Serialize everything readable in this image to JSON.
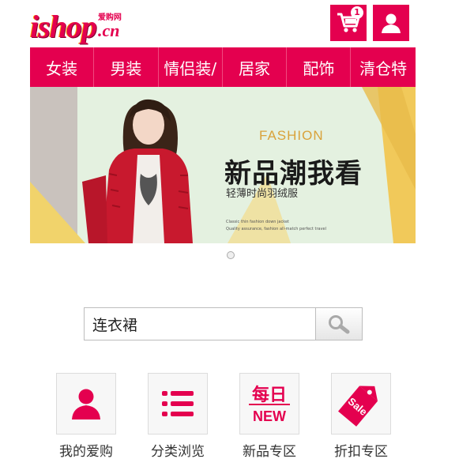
{
  "header": {
    "logo_main": "ishop",
    "logo_sub": "爱购网",
    "logo_suffix": ".cn",
    "cart_icon": "cart-icon",
    "cart_count": "1",
    "user_icon": "user-icon"
  },
  "nav": {
    "items": [
      {
        "label": "女装"
      },
      {
        "label": "男装"
      },
      {
        "label": "情侣装/"
      },
      {
        "label": "居家"
      },
      {
        "label": "配饰"
      },
      {
        "label": "清仓特"
      }
    ]
  },
  "banner": {
    "line1": "FASHION",
    "line2": "新品潮我看",
    "line3": "轻薄时尚羽绒服",
    "line4": "Classic thin fashion down jacket",
    "line5": "Quality assurance, fashion all-match perfect travel",
    "slide_count": 1
  },
  "search": {
    "value": "连衣裙",
    "icon": "search-icon"
  },
  "shortcuts": [
    {
      "label": "我的爱购",
      "icon": "user-icon"
    },
    {
      "label": "分类浏览",
      "icon": "list-icon"
    },
    {
      "label": "新品专区",
      "icon": "new-icon",
      "icon_text_top": "每日",
      "icon_text_bottom": "NEW"
    },
    {
      "label": "折扣专区",
      "icon": "sale-tag-icon",
      "icon_text": "Sale"
    }
  ],
  "colors": {
    "brand": "#e4004f",
    "nav_divider": "#f0497f",
    "tile_bg": "#f7f7f7",
    "banner_bg": "#e3f0df"
  }
}
